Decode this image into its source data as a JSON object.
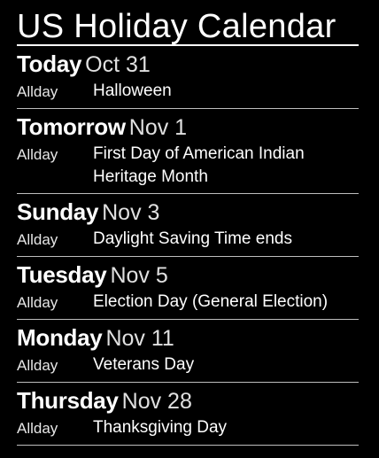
{
  "app": {
    "title": "US Holiday Calendar"
  },
  "days": [
    {
      "name": "Today",
      "date": "Oct 31",
      "events": [
        {
          "time": "Allday",
          "title": "Halloween"
        }
      ]
    },
    {
      "name": "Tomorrow",
      "date": "Nov 1",
      "events": [
        {
          "time": "Allday",
          "title": "First Day of American Indian Heritage Month"
        }
      ]
    },
    {
      "name": "Sunday",
      "date": "Nov 3",
      "events": [
        {
          "time": "Allday",
          "title": "Daylight Saving Time ends"
        }
      ]
    },
    {
      "name": "Tuesday",
      "date": "Nov 5",
      "events": [
        {
          "time": "Allday",
          "title": "Election Day (General Election)"
        }
      ]
    },
    {
      "name": "Monday",
      "date": "Nov 11",
      "events": [
        {
          "time": "Allday",
          "title": "Veterans Day"
        }
      ]
    },
    {
      "name": "Thursday",
      "date": "Nov 28",
      "events": [
        {
          "time": "Allday",
          "title": "Thanksgiving Day"
        }
      ]
    }
  ],
  "colors": {
    "background": "#000000",
    "text": "#ffffff",
    "divider": "#bdbdbd"
  }
}
